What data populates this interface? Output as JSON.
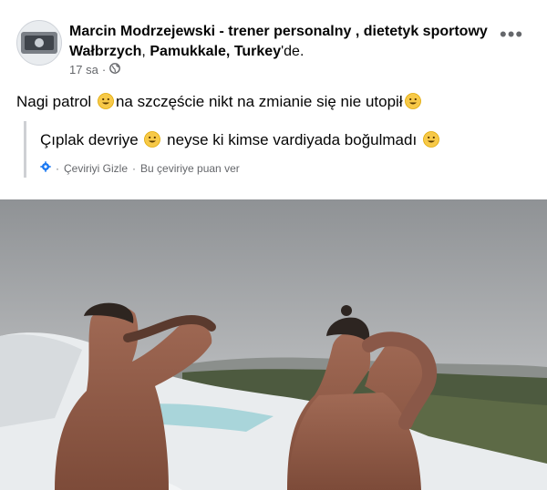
{
  "post": {
    "author_name": "Marcin Modrzejewski - trener personalny , dietetyk sportowy Wałbrzych",
    "separator": ", ",
    "location": "Pamukkale, Turkey",
    "location_suffix": "'de.",
    "timestamp": "17 sa",
    "dot": "·",
    "audience_icon": "globe-icon",
    "more_icon": "more-horizontal-icon",
    "more_glyph": "•••",
    "text_part1": "Nagi patrol ",
    "text_part2": "na szczęście nikt na zmianie się nie utopił",
    "emoji_icon": "smiling-face-icon"
  },
  "translation": {
    "text_part1": "Çıplak devriye ",
    "text_part2": " neyse ki kimse vardiyada boğulmadı ",
    "settings_icon": "gear-icon",
    "hide_label": "Çeviriyi Gizle",
    "sep": "·",
    "rate_label": "Bu çeviriye puan ver"
  },
  "photo": {
    "content": "two-men-at-pamukkale-photo"
  },
  "colors": {
    "primary_text": "#050505",
    "secondary_text": "#65676b",
    "emoji_yellow": "#f7c948",
    "settings_blue": "#1877f2"
  }
}
